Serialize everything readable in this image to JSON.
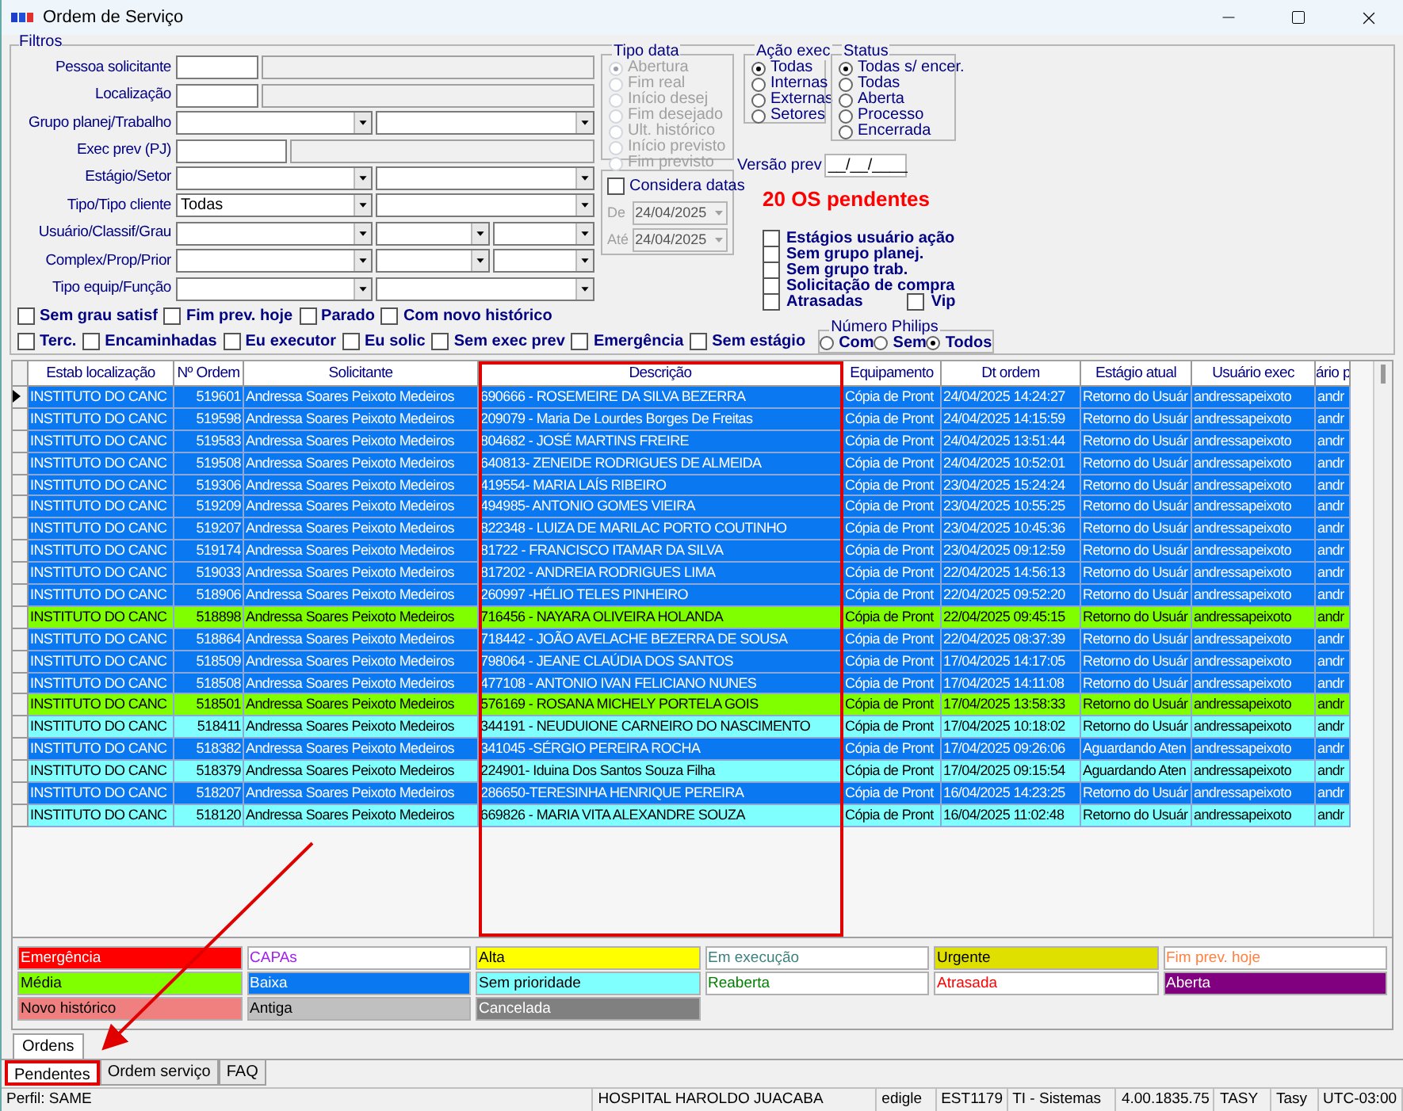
{
  "window": {
    "title": "Ordem de Serviço"
  },
  "filters": {
    "title": "Filtros",
    "fields": [
      {
        "label": "Pessoa solicitante",
        "kind": "lookup"
      },
      {
        "label": "Localização",
        "kind": "lookup"
      },
      {
        "label": "Grupo planej/Trabalho",
        "kind": "combo2"
      },
      {
        "label": "Exec prev (PJ)",
        "kind": "lookup_wide"
      },
      {
        "label": "Estágio/Setor",
        "kind": "combo2"
      },
      {
        "label": "Tipo/Tipo cliente",
        "kind": "combo2",
        "value": "Todas"
      },
      {
        "label": "Usuário/Classif/Grau",
        "kind": "combo3"
      },
      {
        "label": "Complex/Prop/Prior",
        "kind": "combo3"
      },
      {
        "label": "Tipo equip/Função",
        "kind": "combo2"
      }
    ],
    "checkbox_rows": [
      [
        {
          "label": "Sem grau satisf",
          "checked": false
        },
        {
          "label": "Fim prev. hoje",
          "checked": false
        },
        {
          "label": "Parado",
          "checked": false
        },
        {
          "label": "Com novo histórico",
          "checked": false
        }
      ],
      [
        {
          "label": "Terc.",
          "checked": false
        },
        {
          "label": "Encaminhadas",
          "checked": false
        },
        {
          "label": "Eu executor",
          "checked": false
        },
        {
          "label": "Eu solic",
          "checked": false
        },
        {
          "label": "Sem exec prev",
          "checked": false
        },
        {
          "label": "Emergência",
          "checked": false
        },
        {
          "label": "Sem estágio",
          "checked": false
        }
      ]
    ],
    "numero_philips": {
      "title": "Número Philips",
      "options": [
        {
          "label": "Com",
          "selected": false
        },
        {
          "label": "Sem",
          "selected": false
        },
        {
          "label": "Todos",
          "selected": true
        }
      ]
    },
    "tipo_data": {
      "title": "Tipo data",
      "disabled": true,
      "options": [
        {
          "label": "Abertura",
          "selected": true
        },
        {
          "label": "Fim real",
          "selected": false
        },
        {
          "label": "Início desej",
          "selected": false
        },
        {
          "label": "Fim desejado",
          "selected": false
        },
        {
          "label": "Ult. histórico",
          "selected": false
        },
        {
          "label": "Início previsto",
          "selected": false
        },
        {
          "label": "Fim previsto",
          "selected": false
        }
      ]
    },
    "considera_datas": {
      "label": "Considera datas",
      "checked": false,
      "dates": [
        {
          "label": "De",
          "value": "24/04/2025"
        },
        {
          "label": "Até",
          "value": "24/04/2025"
        }
      ]
    },
    "acao_exec": {
      "title": "Ação exec",
      "options": [
        {
          "label": "Todas",
          "selected": true
        },
        {
          "label": "Internas",
          "selected": false
        },
        {
          "label": "Externas",
          "selected": false
        },
        {
          "label": "Setores",
          "selected": false
        }
      ]
    },
    "status": {
      "title": "Status",
      "options": [
        {
          "label": "Todas s/ encer.",
          "selected": true
        },
        {
          "label": "Todas",
          "selected": false
        },
        {
          "label": "Aberta",
          "selected": false
        },
        {
          "label": "Processo",
          "selected": false
        },
        {
          "label": "Encerrada",
          "selected": false
        }
      ]
    },
    "versao_prev": {
      "label": "Versão prev",
      "value": "__/__/____"
    },
    "pending_count": "20 OS pendentes",
    "extra_checks": [
      {
        "label": "Estágios usuário ação",
        "checked": false
      },
      {
        "label": "Sem grupo planej.",
        "checked": false
      },
      {
        "label": "Sem grupo trab.",
        "checked": false
      },
      {
        "label": "Solicitação de compra",
        "checked": false
      }
    ],
    "bottom_checks": [
      {
        "label": "Atrasadas",
        "checked": false
      },
      {
        "label": "Vip",
        "checked": false
      }
    ]
  },
  "table": {
    "columns": [
      {
        "label": "Estab localização",
        "highlighted": false
      },
      {
        "label": "Nº Ordem",
        "highlighted": false
      },
      {
        "label": "Solicitante",
        "highlighted": false
      },
      {
        "label": "Descrição",
        "highlighted": true
      },
      {
        "label": "Equipamento",
        "highlighted": false
      },
      {
        "label": "Dt ordem",
        "highlighted": false
      },
      {
        "label": "Estágio atual",
        "highlighted": false
      },
      {
        "label": "Usuário exec",
        "highlighted": false
      },
      {
        "label": "ário p",
        "highlighted": false
      }
    ],
    "rows": [
      {
        "selected": true,
        "color": "#0a78f0",
        "cells": [
          "INSTITUTO DO CANC",
          "519601",
          "Andressa Soares Peixoto Medeiros",
          "690666 - ROSEMEIRE DA SILVA BEZERRA",
          "Cópia de Pront",
          "24/04/2025 14:24:27",
          "Retorno do Usuár",
          "andressapeixoto",
          "andr"
        ]
      },
      {
        "selected": false,
        "color": "#0a78f0",
        "cells": [
          "INSTITUTO DO CANC",
          "519598",
          "Andressa Soares Peixoto Medeiros",
          "209079 - Maria De Lourdes Borges De Freitas",
          "Cópia de Pront",
          "24/04/2025 14:15:59",
          "Retorno do Usuár",
          "andressapeixoto",
          "andr"
        ]
      },
      {
        "selected": false,
        "color": "#0a78f0",
        "cells": [
          "INSTITUTO DO CANC",
          "519583",
          "Andressa Soares Peixoto Medeiros",
          "804682 - JOSÉ MARTINS FREIRE",
          "Cópia de Pront",
          "24/04/2025 13:51:44",
          "Retorno do Usuár",
          "andressapeixoto",
          "andr"
        ]
      },
      {
        "selected": false,
        "color": "#0a78f0",
        "cells": [
          "INSTITUTO DO CANC",
          "519508",
          "Andressa Soares Peixoto Medeiros",
          "640813- ZENEIDE RODRIGUES DE ALMEIDA",
          "Cópia de Pront",
          "24/04/2025 10:52:01",
          "Retorno do Usuár",
          "andressapeixoto",
          "andr"
        ]
      },
      {
        "selected": false,
        "color": "#0a78f0",
        "cells": [
          "INSTITUTO DO CANC",
          "519306",
          "Andressa Soares Peixoto Medeiros",
          "419554- MARIA LAÍS RIBEIRO",
          "Cópia de Pront",
          "23/04/2025 15:24:24",
          "Retorno do Usuár",
          "andressapeixoto",
          "andr"
        ]
      },
      {
        "selected": false,
        "color": "#0a78f0",
        "cells": [
          "INSTITUTO DO CANC",
          "519209",
          "Andressa Soares Peixoto Medeiros",
          "494985- ANTONIO GOMES VIEIRA",
          "Cópia de Pront",
          "23/04/2025 10:55:25",
          "Retorno do Usuár",
          "andressapeixoto",
          "andr"
        ]
      },
      {
        "selected": false,
        "color": "#0a78f0",
        "cells": [
          "INSTITUTO DO CANC",
          "519207",
          "Andressa Soares Peixoto Medeiros",
          "822348 - LUIZA DE MARILAC PORTO COUTINHO",
          "Cópia de Pront",
          "23/04/2025 10:45:36",
          "Retorno do Usuár",
          "andressapeixoto",
          "andr"
        ]
      },
      {
        "selected": false,
        "color": "#0a78f0",
        "cells": [
          "INSTITUTO DO CANC",
          "519174",
          "Andressa Soares Peixoto Medeiros",
          "81722 - FRANCISCO ITAMAR DA SILVA",
          "Cópia de Pront",
          "23/04/2025 09:12:59",
          "Retorno do Usuár",
          "andressapeixoto",
          "andr"
        ]
      },
      {
        "selected": false,
        "color": "#0a78f0",
        "cells": [
          "INSTITUTO DO CANC",
          "519033",
          "Andressa Soares Peixoto Medeiros",
          "817202 - ANDREIA RODRIGUES LIMA",
          "Cópia de Pront",
          "22/04/2025 14:56:13",
          "Retorno do Usuár",
          "andressapeixoto",
          "andr"
        ]
      },
      {
        "selected": false,
        "color": "#0a78f0",
        "cells": [
          "INSTITUTO DO CANC",
          "518906",
          "Andressa Soares Peixoto Medeiros",
          "260997 -HÉLIO TELES PINHEIRO",
          "Cópia de Pront",
          "22/04/2025 09:52:20",
          "Retorno do Usuár",
          "andressapeixoto",
          "andr"
        ]
      },
      {
        "selected": false,
        "color": "#80ff00",
        "cells": [
          "INSTITUTO DO CANC",
          "518898",
          "Andressa Soares Peixoto Medeiros",
          "716456 - NAYARA OLIVEIRA HOLANDA",
          "Cópia de Pront",
          "22/04/2025 09:45:15",
          "Retorno do Usuár",
          "andressapeixoto",
          "andr"
        ]
      },
      {
        "selected": false,
        "color": "#0a78f0",
        "cells": [
          "INSTITUTO DO CANC",
          "518864",
          "Andressa Soares Peixoto Medeiros",
          "718442 - JOÃO AVELACHE BEZERRA DE SOUSA",
          "Cópia de Pront",
          "22/04/2025 08:37:39",
          "Retorno do Usuár",
          "andressapeixoto",
          "andr"
        ]
      },
      {
        "selected": false,
        "color": "#0a78f0",
        "cells": [
          "INSTITUTO DO CANC",
          "518509",
          "Andressa Soares Peixoto Medeiros",
          "798064 - JEANE CLAÚDIA DOS SANTOS",
          "Cópia de Pront",
          "17/04/2025 14:17:05",
          "Retorno do Usuár",
          "andressapeixoto",
          "andr"
        ]
      },
      {
        "selected": false,
        "color": "#0a78f0",
        "cells": [
          "INSTITUTO DO CANC",
          "518508",
          "Andressa Soares Peixoto Medeiros",
          "477108 - ANTONIO IVAN FELICIANO NUNES",
          "Cópia de Pront",
          "17/04/2025 14:11:08",
          "Retorno do Usuár",
          "andressapeixoto",
          "andr"
        ]
      },
      {
        "selected": false,
        "color": "#80ff00",
        "cells": [
          "INSTITUTO DO CANC",
          "518501",
          "Andressa Soares Peixoto Medeiros",
          "576169 - ROSANA MICHELY PORTELA GOIS",
          "Cópia de Pront",
          "17/04/2025 13:58:33",
          "Retorno do Usuár",
          "andressapeixoto",
          "andr"
        ]
      },
      {
        "selected": false,
        "color": "#80ffff",
        "cells": [
          "INSTITUTO DO CANC",
          "518411",
          "Andressa Soares Peixoto Medeiros",
          "344191 - NEUDUIONE CARNEIRO DO NASCIMENTO",
          "Cópia de Pront",
          "17/04/2025 10:18:02",
          "Retorno do Usuár",
          "andressapeixoto",
          "andr"
        ]
      },
      {
        "selected": false,
        "color": "#0a78f0",
        "cells": [
          "INSTITUTO DO CANC",
          "518382",
          "Andressa Soares Peixoto Medeiros",
          "341045 -SÉRGIO PEREIRA ROCHA",
          "Cópia de Pront",
          "17/04/2025 09:26:06",
          "Aguardando Aten",
          "andressapeixoto",
          "andr"
        ]
      },
      {
        "selected": false,
        "color": "#80ffff",
        "cells": [
          "INSTITUTO DO CANC",
          "518379",
          "Andressa Soares Peixoto Medeiros",
          "224901- Iduina Dos Santos Souza Filha",
          "Cópia de Pront",
          "17/04/2025 09:15:54",
          "Aguardando Aten",
          "andressapeixoto",
          "andr"
        ]
      },
      {
        "selected": false,
        "color": "#0a78f0",
        "cells": [
          "INSTITUTO DO CANC",
          "518207",
          "Andressa Soares Peixoto Medeiros",
          "286650-TERESINHA HENRIQUE PEREIRA",
          "Cópia de Pront",
          "16/04/2025 14:23:25",
          "Retorno do Usuár",
          "andressapeixoto",
          "andr"
        ]
      },
      {
        "selected": false,
        "color": "#80ffff",
        "cells": [
          "INSTITUTO DO CANC",
          "518120",
          "Andressa Soares Peixoto Medeiros",
          "669826 - MARIA VITA ALEXANDRE SOUZA",
          "Cópia de Pront",
          "16/04/2025 11:02:48",
          "Retorno do Usuár",
          "andressapeixoto",
          "andr"
        ]
      }
    ]
  },
  "legend": [
    {
      "label": "Emergência",
      "kind": "fill",
      "color": "#ff0000"
    },
    {
      "label": "CAPAs",
      "kind": "text",
      "color": "#a020f0"
    },
    {
      "label": "Alta",
      "kind": "fill",
      "color": "#ffff00"
    },
    {
      "label": "Em execução",
      "kind": "text",
      "color": "#408080"
    },
    {
      "label": "Urgente",
      "kind": "fill",
      "color": "#e0e000"
    },
    {
      "label": "Fim prev. hoje",
      "kind": "text",
      "color": "#ff8040"
    },
    {
      "label": "Média",
      "kind": "fill",
      "color": "#80ff00"
    },
    {
      "label": "Baixa",
      "kind": "fill",
      "color": "#0a78f0"
    },
    {
      "label": "Sem prioridade",
      "kind": "fill",
      "color": "#80ffff"
    },
    {
      "label": "Reaberta",
      "kind": "text",
      "color": "#008000"
    },
    {
      "label": "Atrasada",
      "kind": "text",
      "color": "#ff0000"
    },
    {
      "label": "Aberta",
      "kind": "fill",
      "color": "#800080"
    },
    {
      "label": "Novo histórico",
      "kind": "fill",
      "color": "#f08080"
    },
    {
      "label": "Antiga",
      "kind": "fill",
      "color": "#c0c0c0"
    },
    {
      "label": "Cancelada",
      "kind": "fill",
      "color": "#808080"
    }
  ],
  "inner_tabs": [
    {
      "label": "Ordens",
      "selected": true
    }
  ],
  "tabs": [
    {
      "label": "Pendentes",
      "selected": true,
      "highlighted": true
    },
    {
      "label": "Ordem serviço",
      "selected": false,
      "highlighted": false
    },
    {
      "label": "FAQ",
      "selected": false,
      "highlighted": false
    }
  ],
  "status_bar": [
    "Perfil: SAME",
    "HOSPITAL HAROLDO JUACABA",
    "edigle",
    "EST1179",
    "TI - Sistemas",
    "4.00.1835.75",
    "TASY",
    "Tasy",
    "UTC-03:00"
  ]
}
